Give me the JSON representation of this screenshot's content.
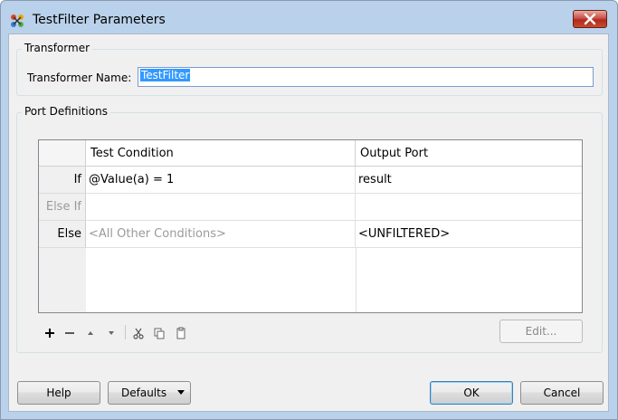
{
  "window": {
    "title": "TestFilter Parameters"
  },
  "transformer_group": {
    "legend": "Transformer",
    "name_label": "Transformer Name:",
    "name_value": "TestFilter"
  },
  "ports_group": {
    "legend": "Port Definitions",
    "columns": [
      "Test Condition",
      "Output Port"
    ],
    "rows": [
      {
        "header": "If",
        "condition": "@Value(a) = 1",
        "output": "result",
        "header_disabled": false,
        "condition_placeholder": false
      },
      {
        "header": "Else If",
        "condition": "",
        "output": "",
        "header_disabled": true,
        "condition_placeholder": false
      },
      {
        "header": "Else",
        "condition": "<All Other Conditions>",
        "output": "<UNFILTERED>",
        "header_disabled": false,
        "condition_placeholder": true
      }
    ],
    "toolbar": {
      "add_icon": "plus-icon",
      "remove_icon": "minus-icon",
      "up_icon": "arrow-up-icon",
      "down_icon": "arrow-down-icon",
      "cut_icon": "scissors-icon",
      "copy_icon": "copy-icon",
      "paste_icon": "paste-icon"
    },
    "edit_label": "Edit..."
  },
  "footer": {
    "help_label": "Help",
    "defaults_label": "Defaults",
    "ok_label": "OK",
    "cancel_label": "Cancel"
  },
  "colors": {
    "title_bar": "#b9d1ea",
    "close_button": "#c75050",
    "selection": "#3399ff",
    "dialog_bg": "#f0f0f0"
  }
}
